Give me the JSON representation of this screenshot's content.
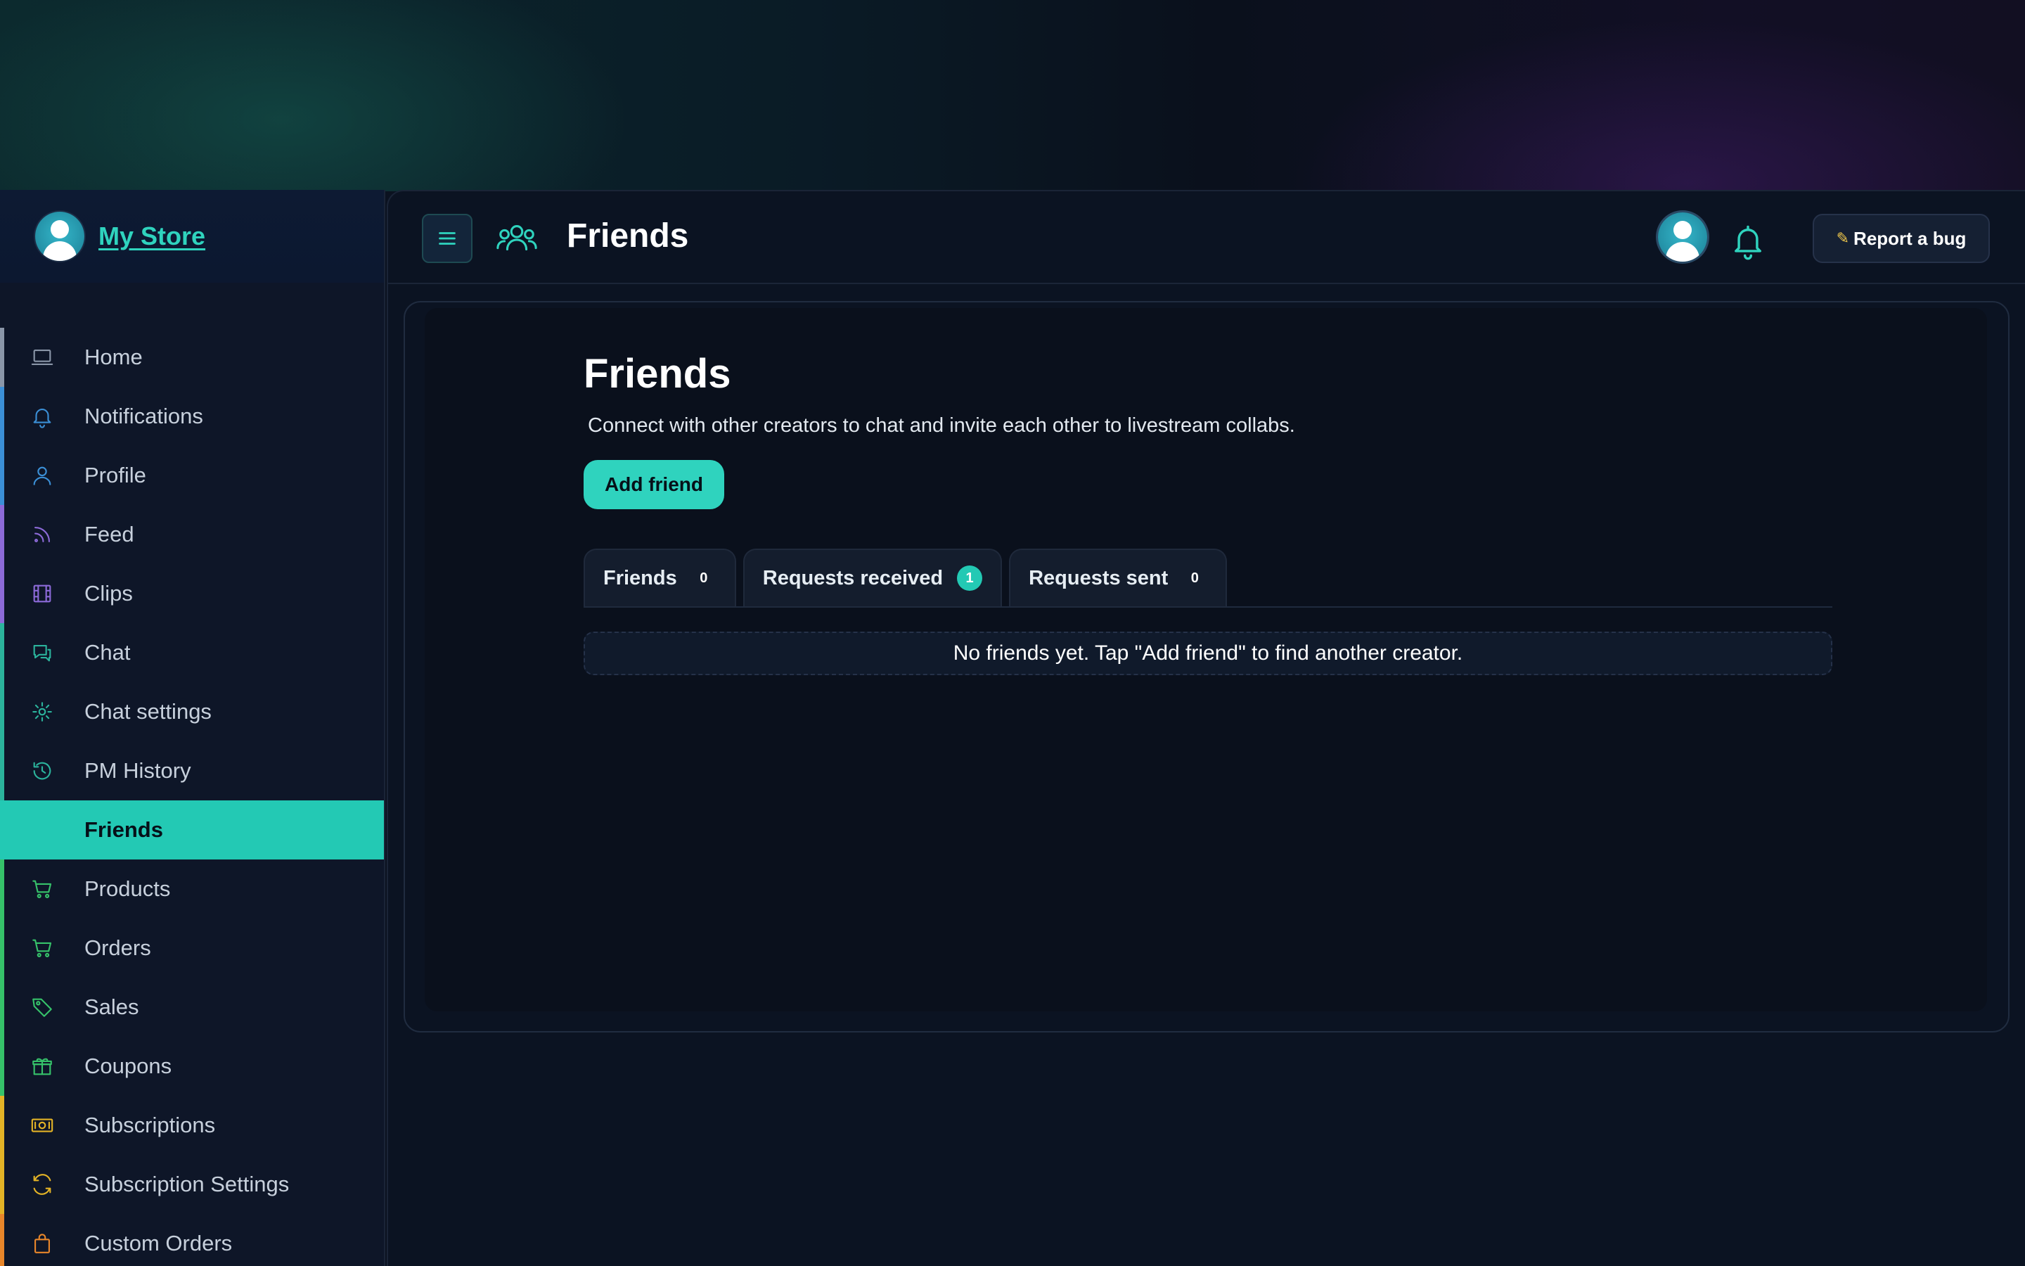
{
  "brand": {
    "name": "My Store"
  },
  "sidebar": {
    "items": [
      {
        "label": "Home",
        "icon": "laptop-icon",
        "color": "#8a96a8",
        "active": false
      },
      {
        "label": "Notifications",
        "icon": "bell-icon",
        "color": "#3b8fd6",
        "active": false
      },
      {
        "label": "Profile",
        "icon": "user-icon",
        "color": "#3b8fd6",
        "active": false
      },
      {
        "label": "Feed",
        "icon": "rss-icon",
        "color": "#8c6ad8",
        "active": false
      },
      {
        "label": "Clips",
        "icon": "film-icon",
        "color": "#8c6ad8",
        "active": false
      },
      {
        "label": "Chat",
        "icon": "chat-icon",
        "color": "#2bb39c",
        "active": false
      },
      {
        "label": "Chat settings",
        "icon": "gear-icon",
        "color": "#2bb39c",
        "active": false
      },
      {
        "label": "PM History",
        "icon": "history-icon",
        "color": "#2bb39c",
        "active": false
      },
      {
        "label": "Friends",
        "icon": "",
        "color": "#23c9b4",
        "active": true
      },
      {
        "label": "Products",
        "icon": "cart-icon",
        "color": "#36c26a",
        "active": false
      },
      {
        "label": "Orders",
        "icon": "cart-icon",
        "color": "#36c26a",
        "active": false
      },
      {
        "label": "Sales",
        "icon": "tag-icon",
        "color": "#36c26a",
        "active": false
      },
      {
        "label": "Coupons",
        "icon": "gift-icon",
        "color": "#36c26a",
        "active": false
      },
      {
        "label": "Subscriptions",
        "icon": "money-icon",
        "color": "#e3b326",
        "active": false
      },
      {
        "label": "Subscription Settings",
        "icon": "refresh-icon",
        "color": "#e3b326",
        "active": false
      },
      {
        "label": "Custom Orders",
        "icon": "bag-icon",
        "color": "#e8862a",
        "active": false
      }
    ]
  },
  "header": {
    "title": "Friends",
    "report_bug_label": "Report a bug"
  },
  "page": {
    "title": "Friends",
    "description": "Connect with other creators to chat and invite each other to livestream collabs.",
    "add_friend_label": "Add friend",
    "tabs": [
      {
        "label": "Friends",
        "count": "0"
      },
      {
        "label": "Requests received",
        "count": "1"
      },
      {
        "label": "Requests sent",
        "count": "0"
      }
    ],
    "empty_message": "No friends yet. Tap \"Add friend\" to find another creator."
  },
  "colors": {
    "accent": "#23c9b4",
    "background": "#0b1322"
  }
}
